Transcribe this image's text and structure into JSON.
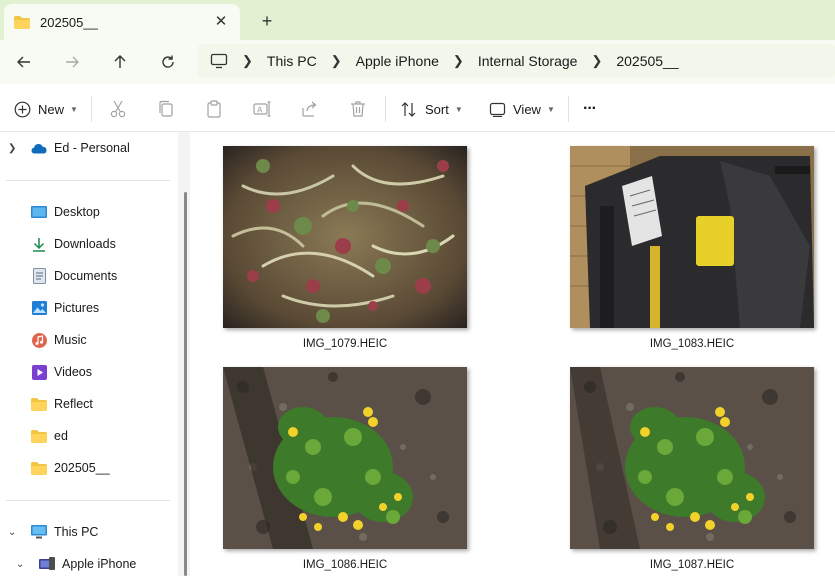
{
  "window": {
    "tab_title": "202505__",
    "tab_close": "✕",
    "new_tab": "+"
  },
  "nav": {
    "breadcrumbs": [
      "This PC",
      "Apple iPhone",
      "Internal Storage",
      "202505__"
    ]
  },
  "commands": {
    "new_label": "New",
    "sort_label": "Sort",
    "view_label": "View",
    "more_label": "···"
  },
  "sidebar": {
    "cloud": {
      "label": "Ed - Personal"
    },
    "quick": [
      {
        "label": "Desktop",
        "icon": "desktop-icon",
        "pinned": true
      },
      {
        "label": "Downloads",
        "icon": "downloads-icon",
        "pinned": true
      },
      {
        "label": "Documents",
        "icon": "documents-icon",
        "pinned": true
      },
      {
        "label": "Pictures",
        "icon": "pictures-icon",
        "pinned": true
      },
      {
        "label": "Music",
        "icon": "music-icon",
        "pinned": true
      },
      {
        "label": "Videos",
        "icon": "videos-icon",
        "pinned": true
      },
      {
        "label": "Reflect",
        "icon": "folder-icon",
        "pinned": false
      },
      {
        "label": "ed",
        "icon": "folder-icon",
        "pinned": false
      },
      {
        "label": "202505__",
        "icon": "folder-icon",
        "pinned": false
      }
    ],
    "this_pc": {
      "label": "This PC"
    },
    "device": {
      "label": "Apple iPhone"
    }
  },
  "files": [
    {
      "name": "IMG_1079.HEIC",
      "subject": "salad"
    },
    {
      "name": "IMG_1083.HEIC",
      "subject": "suitcase"
    },
    {
      "name": "IMG_1086.HEIC",
      "subject": "yellow-flower-plant"
    },
    {
      "name": "IMG_1087.HEIC",
      "subject": "yellow-flower-plant"
    }
  ],
  "colors": {
    "tabstrip": "#e3f1d3",
    "toolbar": "#f7fbf3",
    "accent": "#0067c0"
  }
}
